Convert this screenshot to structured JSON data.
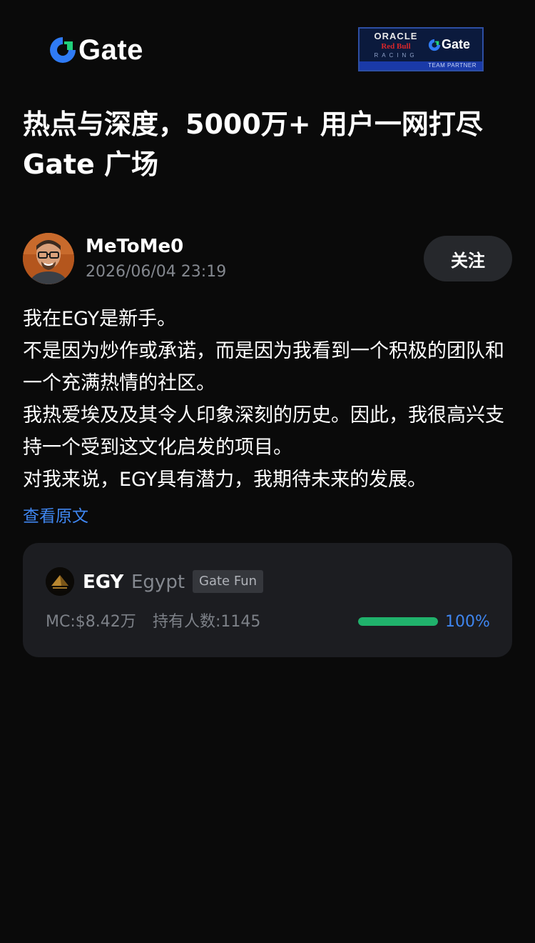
{
  "brand": {
    "logo_text": "Gate",
    "accent_color": "#3f86f0"
  },
  "partner_badge": {
    "oracle": "ORACLE",
    "redbull": "Red Bull",
    "racing": "RACING",
    "gate": "Gate",
    "strip": "TEAM PARTNER"
  },
  "headline": "热点与深度，5000万+ 用户一网打尽 Gate 广场",
  "post": {
    "author_name": "MeToMe0",
    "timestamp": "2026/06/04 23:19",
    "follow_label": "关注",
    "paragraphs": [
      "我在EGY是新手。",
      "不是因为炒作或承诺，而是因为我看到一个积极的团队和一个充满热情的社区。",
      "我热爱埃及及其令人印象深刻的历史。因此，我很高兴支持一个受到这文化启发的项目。",
      "对我来说，EGY具有潜力，我期待未来的发展。"
    ],
    "view_original": "查看原文"
  },
  "token": {
    "symbol": "EGY",
    "name": "Egypt",
    "tag": "Gate Fun",
    "market_cap": "MC:$8.42万",
    "holders": "持有人数:1145",
    "progress_label": "100%",
    "progress_fraction": 1.0,
    "progress_color": "#20b26c"
  }
}
